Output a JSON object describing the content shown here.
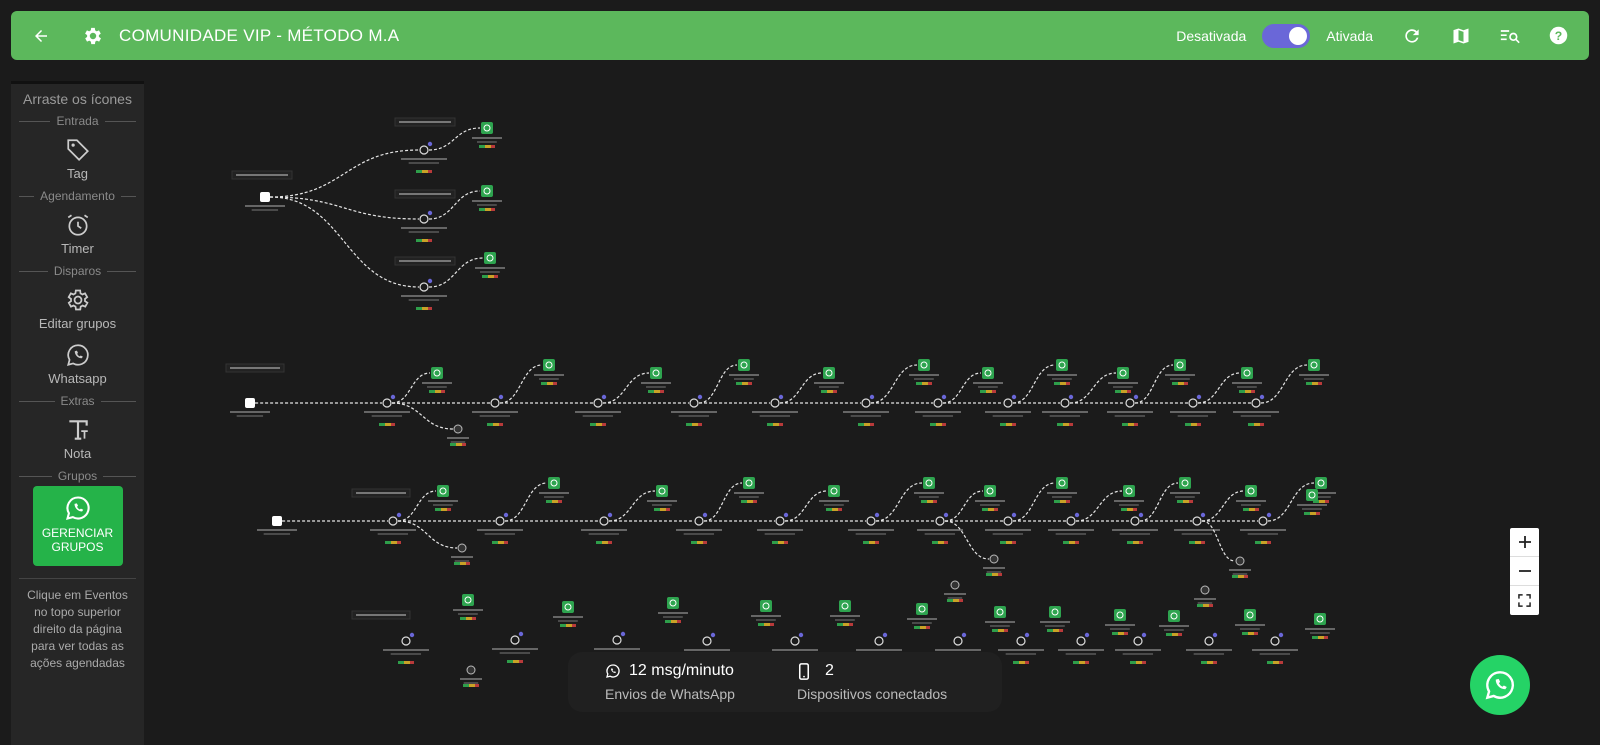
{
  "header": {
    "title": "COMUNIDADE VIP - MÉTODO M.A",
    "toggle_off_label": "Desativada",
    "toggle_on_label": "Ativada",
    "toggle_state": "on",
    "color": "#5cb85c",
    "icons": [
      "back-arrow-icon",
      "gear-icon",
      "refresh-icon",
      "map-icon",
      "search-list-icon",
      "help-icon"
    ]
  },
  "sidebar": {
    "heading": "Arraste os ícones",
    "sections": {
      "entrada": "Entrada",
      "agendamento": "Agendamento",
      "disparos": "Disparos",
      "extras": "Extras",
      "grupos": "Grupos"
    },
    "items": {
      "tag": "Tag",
      "timer": "Timer",
      "edit_groups": "Editar grupos",
      "whatsapp": "Whatsapp",
      "note": "Nota"
    },
    "manage_button": "GERENCIAR GRUPOS",
    "help_text": "Clique em Eventos no topo superior direito da página para ver todas as ações agendadas"
  },
  "stats": {
    "rate_value": "12 msg/minuto",
    "rate_label": "Envios de WhatsApp",
    "devices_value": "2",
    "devices_label": "Dispositivos conectados"
  },
  "zoom": {
    "in": "+",
    "out": "−",
    "fit": "fit"
  },
  "colors": {
    "accent": "#6a67d8",
    "whatsapp": "#25d366",
    "node_green": "#2ea44f",
    "background": "#1b1b1b"
  }
}
